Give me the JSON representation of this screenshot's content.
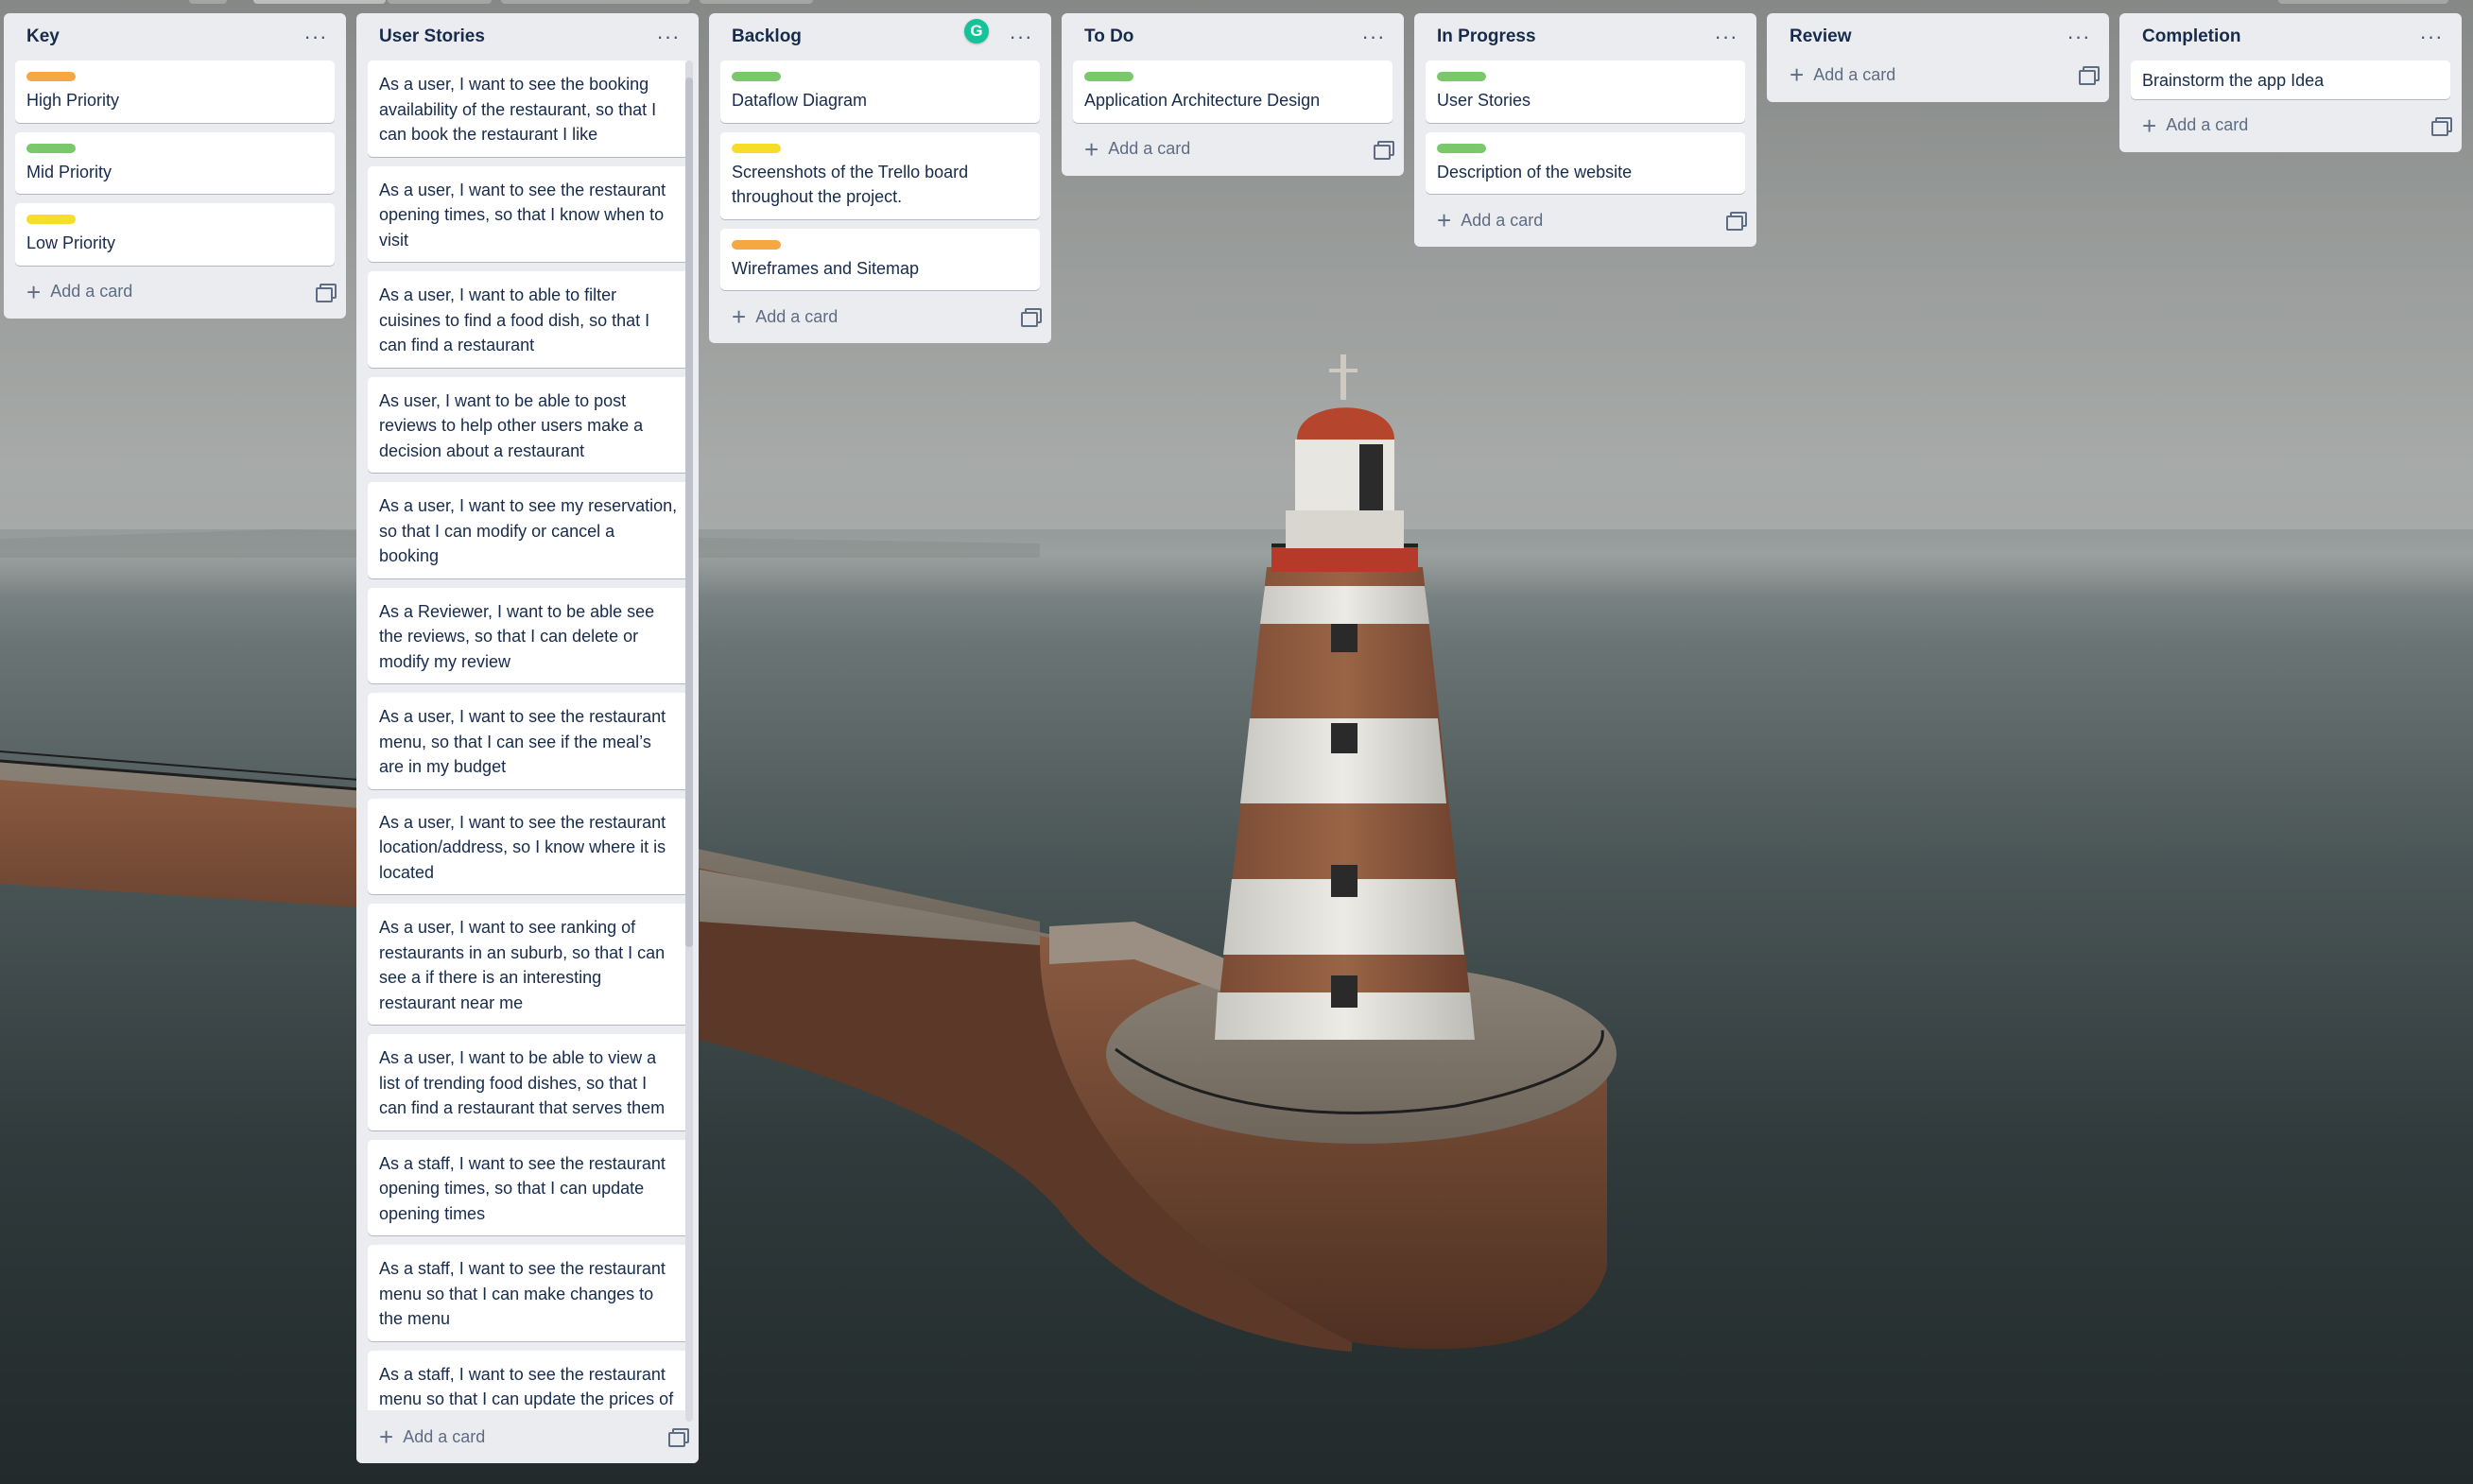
{
  "colors": {
    "high": "#f5a742",
    "mid": "#7bc86c",
    "low": "#f5dd29"
  },
  "lists": [
    {
      "id": "key",
      "title": "Key",
      "cards": [
        {
          "label": "high",
          "text": "High Priority"
        },
        {
          "label": "mid",
          "text": "Mid Priority"
        },
        {
          "label": "low",
          "text": "Low Priority"
        }
      ],
      "add_label": "Add a card"
    },
    {
      "id": "user-stories",
      "title": "User Stories",
      "cards": [
        {
          "text": "As a user, I want to see the booking availability of the restaurant, so that I can book the restaurant I like"
        },
        {
          "text": "As a user, I want to see the restaurant opening times, so that I know when to visit"
        },
        {
          "text": "As a user, I want to able to filter cuisines to find a food dish, so that I can find a restaurant"
        },
        {
          "text": "As user, I want to be able to post reviews to help other users make a decision about a restaurant"
        },
        {
          "text": "As a user, I want to see my reservation, so that I can modify or cancel a booking"
        },
        {
          "text": "As a Reviewer, I want to be able see the reviews, so that I can delete or modify my review"
        },
        {
          "text": "As a user, I want to see the restaurant menu, so that I can see if the meal’s are in my budget"
        },
        {
          "text": "As a user, I want to see the restaurant location/address, so I know where it is located"
        },
        {
          "text": "As a user, I want to see ranking of restaurants in an suburb, so that I can see a if there is an interesting restaurant near me"
        },
        {
          "text": "As a user, I want to be able to view a list of trending food dishes, so that I can find a restaurant that serves them"
        },
        {
          "text": "As a staff, I want to see the restaurant opening times, so that I can update opening times"
        },
        {
          "text": "As a staff, I want to see the restaurant menu so that I can make changes to the menu"
        },
        {
          "text": "As a staff, I want to see the restaurant menu so that I can update the prices of the menu"
        }
      ],
      "add_label": "Add a card"
    },
    {
      "id": "backlog",
      "title": "Backlog",
      "cards": [
        {
          "label": "mid",
          "text": "Dataflow Diagram"
        },
        {
          "label": "low",
          "text": "Screenshots of the Trello board throughout the project."
        },
        {
          "label": "high",
          "text": "Wireframes and Sitemap"
        }
      ],
      "add_label": "Add a card"
    },
    {
      "id": "to-do",
      "title": "To Do",
      "cards": [
        {
          "label": "mid",
          "text": "Application Architecture Design"
        }
      ],
      "add_label": "Add a card"
    },
    {
      "id": "in-progress",
      "title": "In Progress",
      "cards": [
        {
          "label": "mid",
          "text": "User Stories"
        },
        {
          "label": "mid",
          "text": "Description of the website"
        }
      ],
      "add_label": "Add a card"
    },
    {
      "id": "review",
      "title": "Review",
      "cards": [],
      "add_label": "Add a card"
    },
    {
      "id": "completion",
      "title": "Completion",
      "cards": [
        {
          "text": "Brainstorm the app Idea"
        }
      ],
      "add_label": "Add a card"
    }
  ],
  "icons": {
    "list_menu": "more-horizontal-icon",
    "add": "plus-icon",
    "template": "card-template-icon",
    "extension": "grammarly-icon"
  },
  "list_menu_glyph": "···",
  "add_glyph": "+",
  "grammarly_glyph": "G"
}
